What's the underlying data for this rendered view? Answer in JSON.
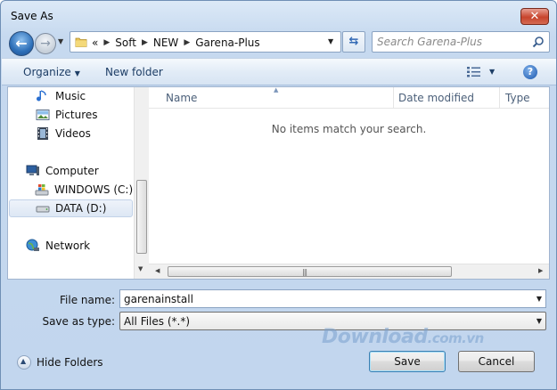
{
  "window": {
    "title": "Save As",
    "close_label": "✕"
  },
  "address": {
    "crumbs": [
      "Soft",
      "NEW",
      "Garena-Plus"
    ],
    "lead": "«"
  },
  "search": {
    "placeholder": "Search Garena-Plus"
  },
  "toolbar": {
    "organize_label": "Organize",
    "new_folder_label": "New folder",
    "help_label": "?"
  },
  "nav": {
    "items": [
      {
        "label": "Music",
        "icon": "music-icon"
      },
      {
        "label": "Pictures",
        "icon": "pictures-icon"
      },
      {
        "label": "Videos",
        "icon": "videos-icon"
      },
      {
        "label": "Computer",
        "icon": "computer-icon"
      },
      {
        "label": "WINDOWS (C:)",
        "icon": "windows-drive-icon"
      },
      {
        "label": "DATA (D:)",
        "icon": "hard-drive-icon",
        "selected": true
      },
      {
        "label": "Network",
        "icon": "network-icon"
      }
    ]
  },
  "files": {
    "columns": [
      "Name",
      "Date modified",
      "Type"
    ],
    "empty_message": "No items match your search."
  },
  "form": {
    "file_name_label": "File name:",
    "file_name_value": "garenainstall",
    "save_type_label": "Save as type:",
    "save_type_value": "All Files (*.*)"
  },
  "footer": {
    "hide_folders_label": "Hide Folders",
    "save_label": "Save",
    "cancel_label": "Cancel"
  },
  "watermark": {
    "main": "Download",
    "suffix": ".com.vn"
  },
  "colors": {
    "accent": "#3269b4",
    "close": "#c7442d",
    "default_button_border": "#3c7fb1"
  }
}
